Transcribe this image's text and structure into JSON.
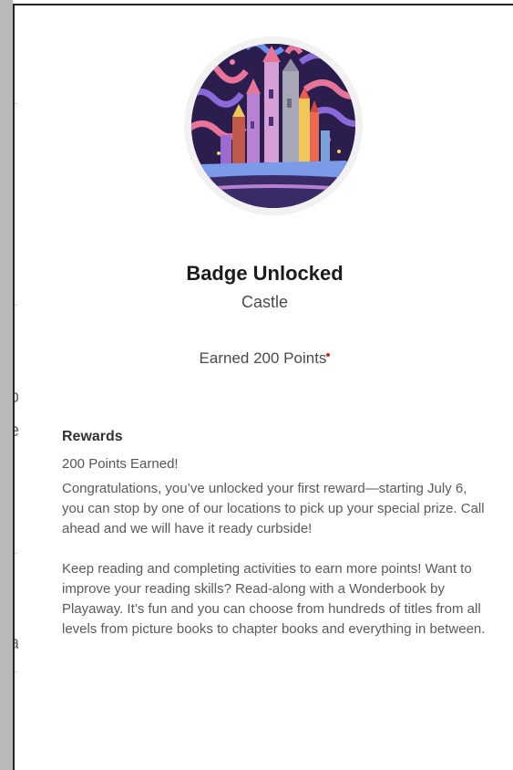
{
  "badge": {
    "image_name": "castle-badge-illustration",
    "title": "Badge Unlocked",
    "subtitle": "Castle",
    "points_text": "Earned 200 Points"
  },
  "rewards": {
    "heading": "Rewards",
    "earned": "200 Points Earned!",
    "paragraph_1": "Congratulations, you’ve unlocked your first reward—starting July 6, you can stop by one of our locations to pick up your special prize. Call ahead and we will have it ready curbside!",
    "paragraph_2": "Keep reading and completing activities to earn more points! Want to improve your reading skills? Read-along with a Wonderbook by Playaway. It’s fun and you can choose from hundreds of titles from all levels from picture books to chapter books and everything in between."
  },
  "background": {
    "glyphs": [
      "o",
      "e",
      "a"
    ]
  },
  "colors": {
    "indicator_dot": "#d8222a",
    "title_text": "#1c1c1c",
    "body_text": "#5a5a5a"
  }
}
